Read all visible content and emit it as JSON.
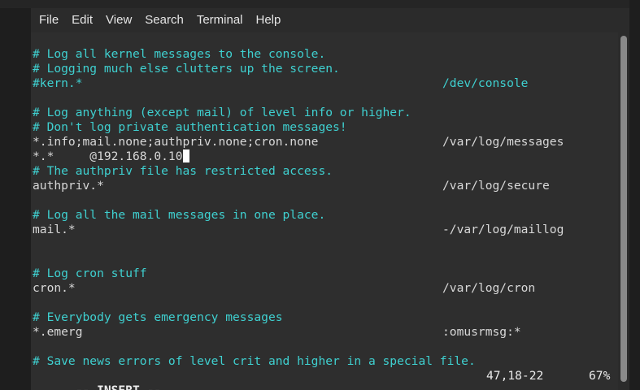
{
  "menubar": {
    "items": [
      "File",
      "Edit",
      "View",
      "Search",
      "Terminal",
      "Help"
    ]
  },
  "editor": {
    "lines": [
      {
        "text": "",
        "target": ""
      },
      {
        "text": "# Log all kernel messages to the console.",
        "target": ""
      },
      {
        "text": "# Logging much else clutters up the screen.",
        "target": ""
      },
      {
        "text": "#kern.*",
        "target": "/dev/console"
      },
      {
        "text": "",
        "target": ""
      },
      {
        "text": "# Log anything (except mail) of level info or higher.",
        "target": ""
      },
      {
        "text": "# Don't log private authentication messages!",
        "target": ""
      },
      {
        "text": "*.info;mail.none;authpriv.none;cron.none",
        "target": "/var/log/messages"
      },
      {
        "text": "*.*     @192.168.0.10",
        "target": ""
      },
      {
        "text": "# The authpriv file has restricted access.",
        "target": ""
      },
      {
        "text": "authpriv.*",
        "target": "/var/log/secure"
      },
      {
        "text": "",
        "target": ""
      },
      {
        "text": "# Log all the mail messages in one place.",
        "target": ""
      },
      {
        "text": "mail.*",
        "target": "-/var/log/maillog"
      },
      {
        "text": "",
        "target": ""
      },
      {
        "text": "",
        "target": ""
      },
      {
        "text": "# Log cron stuff",
        "target": ""
      },
      {
        "text": "cron.*",
        "target": "/var/log/cron"
      },
      {
        "text": "",
        "target": ""
      },
      {
        "text": "# Everybody gets emergency messages",
        "target": ""
      },
      {
        "text": "*.emerg",
        "target": ":omusrmsg:*"
      },
      {
        "text": "",
        "target": ""
      },
      {
        "text": "# Save news errors of level crit and higher in a special file.",
        "target": ""
      }
    ]
  },
  "statusline": {
    "mode": "-- INSERT --",
    "position": "47,18-22",
    "percent": "67%"
  },
  "colors": {
    "comment": "#3fd0d0",
    "text": "#d8d8d8",
    "background": "#2e2e2e"
  }
}
